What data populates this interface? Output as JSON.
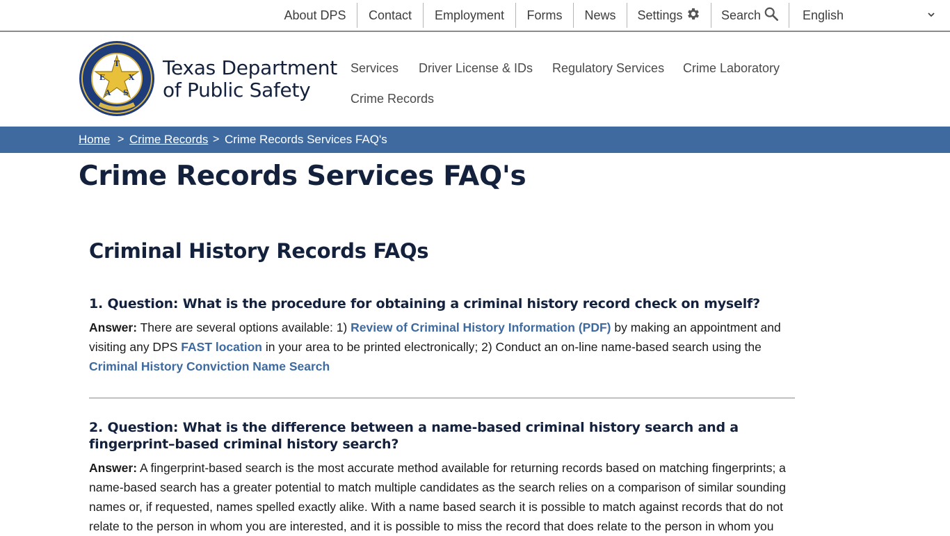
{
  "utility_nav": {
    "about": "About DPS",
    "contact": "Contact",
    "employment": "Employment",
    "forms": "Forms",
    "news": "News",
    "settings": "Settings",
    "search": "Search",
    "language": "English"
  },
  "header": {
    "agency_line1": "Texas Department",
    "agency_line2": "of Public Safety",
    "nav": [
      "Services",
      "Driver License & IDs",
      "Regulatory Services",
      "Crime Laboratory",
      "Crime Records"
    ]
  },
  "logo": {
    "letters": [
      "T",
      "E",
      "X",
      "A",
      "S"
    ]
  },
  "breadcrumb": {
    "home": "Home",
    "crime_records": "Crime Records",
    "current": "Crime Records Services FAQ's",
    "separator": ">"
  },
  "page": {
    "title": "Crime Records Services FAQ's",
    "section_title": "Criminal History Records FAQs"
  },
  "faq": [
    {
      "question": "1. Question: What is the procedure for obtaining a criminal history record check on myself?",
      "answer_label": "Answer:",
      "answer_t1": " There are several options available: 1) ",
      "link1": "Review of Criminal History Information (PDF)",
      "answer_t2": " by making an appointment and visiting any DPS ",
      "link2": "FAST location",
      "answer_t3": " in your area to be printed electronically; 2) Conduct an on-line name-based search using the ",
      "link3": "Criminal History Conviction Name Search"
    },
    {
      "question": "2. Question: What is the difference between a name-based criminal history search and a fingerprint–based criminal history search?",
      "answer_label": "Answer:",
      "answer_text": " A fingerprint-based search is the most accurate method available for returning records based on matching fingerprints; a name-based search has a greater potential to match multiple candidates as the search relies on a comparison of similar sounding names or, if requested, names spelled exactly alike. With a name based search it is possible to match against records that do not relate to the person in whom you are interested, and it is possible to miss the record that does relate to the person in whom you"
    }
  ],
  "colors": {
    "breadcrumb_bar": "#3e6aa0",
    "heading": "#14213d",
    "link": "#3e6aa0",
    "nav_text": "#4a4a4a"
  }
}
